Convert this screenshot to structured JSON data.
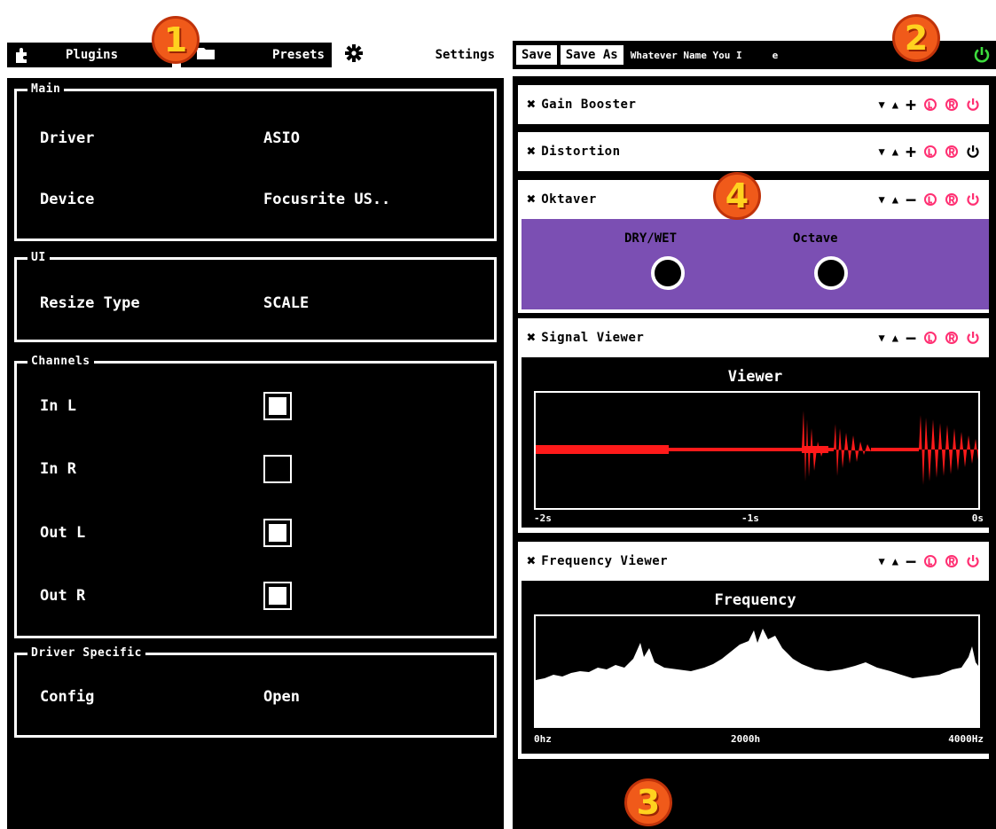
{
  "top_nav": {
    "plugins_label": "Plugins",
    "presets_label": "Presets",
    "settings_label": "Settings"
  },
  "preset_bar": {
    "save_label": "Save",
    "save_as_label": "Save As",
    "preset_name": "Whatever Name You I",
    "preset_name_tail": "e"
  },
  "settings": {
    "main": {
      "title": "Main",
      "driver_label": "Driver",
      "driver_value": "ASIO",
      "device_label": "Device",
      "device_value": "Focusrite US.."
    },
    "ui": {
      "title": "UI",
      "resize_label": "Resize Type",
      "resize_value": "SCALE"
    },
    "channels": {
      "title": "Channels",
      "items": [
        {
          "label": "In L",
          "checked": true
        },
        {
          "label": "In R",
          "checked": false
        },
        {
          "label": "Out L",
          "checked": true
        },
        {
          "label": "Out R",
          "checked": true
        }
      ]
    },
    "driver_specific": {
      "title": "Driver Specific",
      "config_label": "Config",
      "config_value": "Open"
    }
  },
  "plugins": [
    {
      "name": "Gain Booster",
      "expand_sign": "+",
      "power_color": "#ff2f72"
    },
    {
      "name": "Distortion",
      "expand_sign": "+",
      "power_color": "#000000"
    },
    {
      "name": "Oktaver",
      "expand_sign": "−",
      "power_color": "#ff2f72",
      "knobs": [
        {
          "label": "DRY/WET"
        },
        {
          "label": "Octave"
        }
      ],
      "body_color": "#7b4fb3"
    },
    {
      "name": "Signal Viewer",
      "expand_sign": "−",
      "power_color": "#ff2f72",
      "viewer_title": "Viewer",
      "axis_labels": [
        "-2s",
        "-1s",
        "0s"
      ]
    },
    {
      "name": "Frequency Viewer",
      "expand_sign": "−",
      "power_color": "#ff2f72",
      "viewer_title": "Frequency",
      "axis_labels": [
        "0hz",
        "2000h",
        "4000Hz"
      ]
    }
  ],
  "callouts": [
    "1",
    "2",
    "3",
    "4"
  ],
  "colors": {
    "accent_pink": "#ff2f72",
    "power_green": "#3ddc3d",
    "waveform_red": "#ff1a1a",
    "oktaver_purple": "#7b4fb3",
    "callout_orange": "#f05a1a"
  },
  "icons": {
    "plugins": "puzzle-icon",
    "presets": "folder-icon",
    "settings": "gear-icon",
    "remove": "x-icon",
    "move_down": "triangle-down-icon",
    "move_up": "triangle-up-icon",
    "input": "l-circle-icon",
    "output": "r-circle-icon",
    "bypass": "power-icon"
  }
}
